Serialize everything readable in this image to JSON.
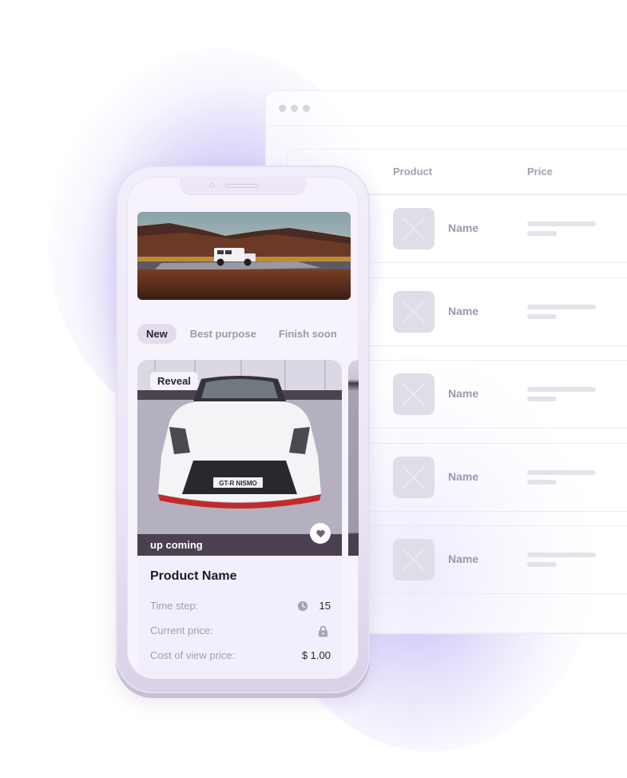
{
  "browser": {
    "window_dots": 3,
    "table": {
      "columns": [
        "Product",
        "Price"
      ],
      "rows": [
        {
          "name": "Name",
          "thumb": "image-placeholder-icon"
        },
        {
          "name": "Name",
          "thumb": "image-placeholder-icon"
        },
        {
          "name": "Name",
          "thumb": "image-placeholder-icon"
        },
        {
          "name": "Name",
          "thumb": "image-placeholder-icon"
        },
        {
          "name": "Name",
          "thumb": "image-placeholder-icon"
        }
      ]
    }
  },
  "phone": {
    "banner": {
      "alt": "white off-road vehicle crossing river in mountains"
    },
    "tabs": [
      {
        "label": "New",
        "active": true
      },
      {
        "label": "Best purpose",
        "active": false
      },
      {
        "label": "Finish soon",
        "active": false
      }
    ],
    "card": {
      "badge": "Reveal",
      "image_alt": "white sports car front view",
      "plate": "GT-R NISMO",
      "status": "up coming",
      "favorite_icon": "heart-icon",
      "product_name": "Product Name",
      "rows": [
        {
          "label": "Time step:",
          "icon": "clock-icon",
          "value": "15"
        },
        {
          "label": "Current price:",
          "icon": "lock-icon",
          "value": ""
        },
        {
          "label": "Cost of view price:",
          "icon": "",
          "value": "$ 1.00"
        }
      ]
    }
  },
  "colors": {
    "accent_glow": "#9682eb",
    "status_bar": "#4a4050",
    "tab_active_bg": "#e3dced",
    "text_dark": "#1e1a28",
    "text_muted": "#a29eb2"
  }
}
